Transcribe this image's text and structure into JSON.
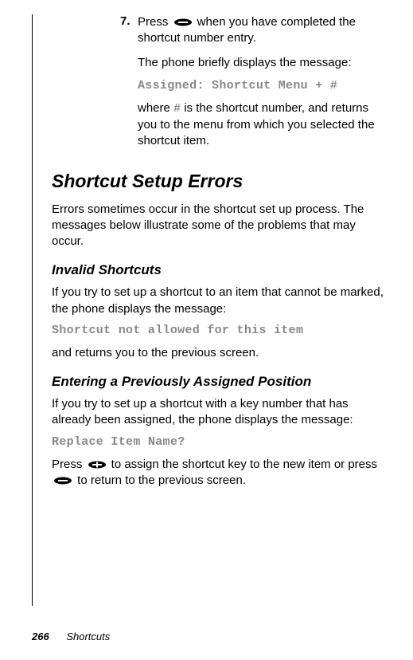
{
  "step": {
    "number": "7.",
    "line1a": "Press ",
    "line1b": " when you have completed the shortcut number entry.",
    "line2": "The phone briefly displays the message:",
    "message": "Assigned: Shortcut Menu + #",
    "line3a": "where ",
    "hash": "#",
    "line3b": " is the shortcut number, and returns you to the menu from which you selected the shortcut item."
  },
  "heading1": "Shortcut Setup Errors",
  "intro": "Errors sometimes occur in the shortcut set up process. The messages below illustrate some of the problems that may occur.",
  "sub1": {
    "title": "Invalid Shortcuts",
    "p1": "If you try to set up a shortcut to an item that cannot be marked, the phone displays the message:",
    "msg": "Shortcut not allowed for this item",
    "p2": "and returns you to the previous screen."
  },
  "sub2": {
    "title": "Entering a Previously Assigned Position",
    "p1": "If you try to set up a shortcut with a key number that has already been assigned, the phone displays the message:",
    "msg": "Replace Item Name?",
    "p2a": "Press ",
    "p2b": " to assign the shortcut key to the new item or press ",
    "p2c": " to return to the previous screen."
  },
  "footer": {
    "page": "266",
    "chapter": "Shortcuts"
  }
}
